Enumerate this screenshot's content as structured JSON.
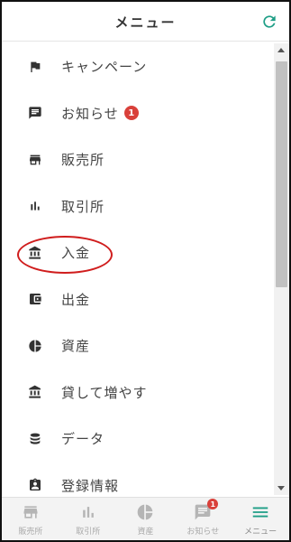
{
  "header": {
    "title": "メニュー",
    "refresh_icon": "refresh-icon",
    "accent_color": "#1e9e86"
  },
  "menu": {
    "items": [
      {
        "label": "キャンペーン",
        "icon": "flag-icon"
      },
      {
        "label": "お知らせ",
        "icon": "message-icon",
        "badge": "1"
      },
      {
        "label": "販売所",
        "icon": "store-icon"
      },
      {
        "label": "取引所",
        "icon": "bar-chart-icon"
      },
      {
        "label": "入金",
        "icon": "bank-icon",
        "highlighted": true
      },
      {
        "label": "出金",
        "icon": "wallet-icon"
      },
      {
        "label": "資産",
        "icon": "pie-chart-icon"
      },
      {
        "label": "貸して増やす",
        "icon": "bank-icon"
      },
      {
        "label": "データ",
        "icon": "database-icon"
      },
      {
        "label": "登録情報",
        "icon": "profile-icon"
      }
    ]
  },
  "tabbar": {
    "items": [
      {
        "label": "販売所",
        "icon": "store-icon"
      },
      {
        "label": "取引所",
        "icon": "bar-chart-icon"
      },
      {
        "label": "資産",
        "icon": "pie-chart-icon"
      },
      {
        "label": "お知らせ",
        "icon": "message-icon",
        "badge": "1"
      },
      {
        "label": "メニュー",
        "icon": "menu-icon",
        "active": true
      }
    ]
  },
  "colors": {
    "badge": "#d9403a",
    "highlight_circle": "#d01d1d",
    "menu_icon": "#333333",
    "tab_icon_inactive": "#b5b5b5",
    "tab_icon_active": "#1e9e86"
  }
}
